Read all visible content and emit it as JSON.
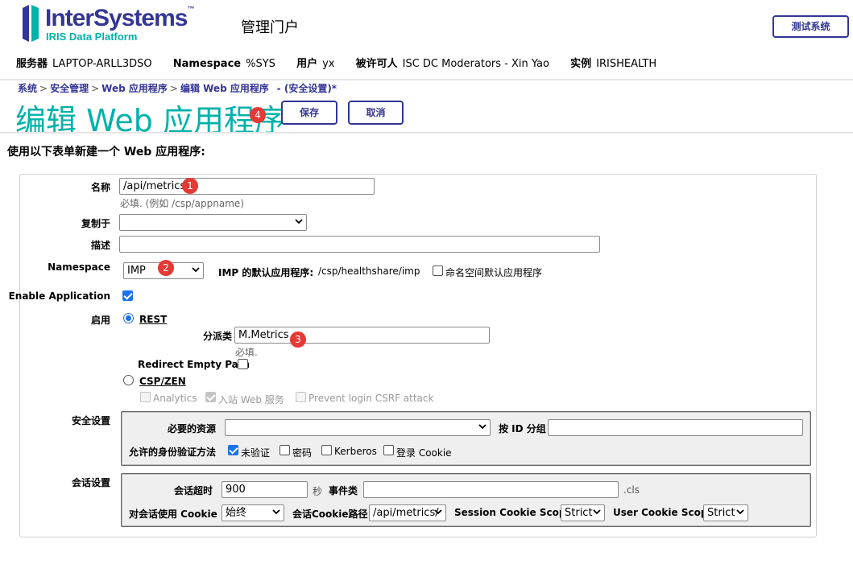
{
  "header": {
    "logo": {
      "name": "InterSystems",
      "tm": "™",
      "subtitle": "IRIS Data Platform",
      "brand_color": "#333695",
      "accent_color": "#00b2a9"
    },
    "portal_title": "管理门户",
    "test_button": "测试系统"
  },
  "info": {
    "server_label": "服务器",
    "server": "LAPTOP-ARLL3DSO",
    "namespace_label": "Namespace",
    "namespace": "%SYS",
    "user_label": "用户",
    "user": "yx",
    "licensee_label": "被许可人",
    "licensee": "ISC DC Moderators - Xin Yao",
    "instance_label": "实例",
    "instance": "IRISHEALTH"
  },
  "breadcrumb": {
    "items": [
      "系统",
      "安全管理",
      "Web 应用程序",
      "编辑 Web 应用程序"
    ],
    "separator": ">",
    "suffix": "- (安全设置)*"
  },
  "title": {
    "text": "编辑 Web 应用程序",
    "save": "保存",
    "cancel": "取消"
  },
  "intro": "使用以下表单新建一个 Web 应用程序:",
  "form": {
    "name_label": "名称",
    "name_value": "/api/metrics",
    "name_hint": "必填.  (例如 /csp/appname)",
    "copy_label": "复制于",
    "copy_value": "",
    "desc_label": "描述",
    "desc_value": "",
    "ns_label": "Namespace",
    "ns_value": "IMP",
    "ns_default_label": "IMP 的默认应用程序:",
    "ns_default_value": "/csp/healthshare/imp",
    "ns_default_check": "命名空间默认应用程序",
    "enable_app_label": "Enable Application",
    "enable_label": "启用",
    "rest_label": "REST",
    "dispatch_label": "分派类",
    "dispatch_value": "M.Metrics",
    "dispatch_hint": "必填.",
    "redirect_label": "Redirect Empty Path",
    "csp_label": "CSP/ZEN",
    "analytics": "Analytics",
    "inbound": "入站 Web 服务",
    "csrf": "Prevent login CSRF attack"
  },
  "security": {
    "section_label": "安全设置",
    "resource_label": "必要的资源",
    "resource_value": "",
    "group_label": "按 ID 分组",
    "group_value": "",
    "auth_label": "允许的身份验证方法",
    "unauth": "未验证",
    "password": "密码",
    "kerberos": "Kerberos",
    "login_cookie": "登录 Cookie"
  },
  "session": {
    "section_label": "会话设置",
    "timeout_label": "会话超时",
    "timeout_value": "900",
    "timeout_unit": "秒",
    "event_label": "事件类",
    "event_value": "",
    "event_suffix": ".cls",
    "use_cookie_label": "对会话使用 Cookie",
    "use_cookie_value": "始终",
    "cookie_path_label": "会话Cookie路径",
    "cookie_path_value": "/api/metrics/",
    "session_scope_label": "Session Cookie Scope",
    "session_scope_value": "Strict",
    "user_scope_label": "User Cookie Scope",
    "user_scope_value": "Strict"
  },
  "badges": [
    "1",
    "2",
    "3",
    "4"
  ]
}
